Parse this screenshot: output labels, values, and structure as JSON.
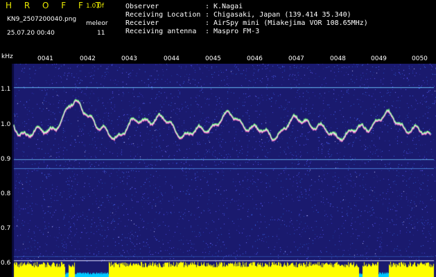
{
  "header": {
    "app_title": "H R O F F T",
    "version": "1.0.0f",
    "file_name": "KN9_2507200040.png",
    "mode_label": "meleor",
    "datetime": "25.07.20 00:40",
    "mode_value": "11",
    "info": [
      {
        "key": "Observer",
        "sep": ":",
        "value": "K.Nagai"
      },
      {
        "key": "Receiving Location",
        "sep": ":",
        "value": "Chigasaki, Japan (139.414 35.340)"
      },
      {
        "key": "Receiver",
        "sep": ":",
        "value": "AirSpy mini (Miakejima VOR 108.65MHz)"
      },
      {
        "key": "Receiving antenna",
        "sep": ":",
        "value": "Maspro FM-3"
      }
    ]
  },
  "axis": {
    "unit": "kHz",
    "time_labels": [
      "0041",
      "0042",
      "0043",
      "0044",
      "0045",
      "0046",
      "0047",
      "0048",
      "0049",
      "0050"
    ],
    "freq_labels": [
      "1.1",
      "1.0",
      "0.9",
      "0.8",
      "0.7",
      "0.6"
    ]
  },
  "colors": {
    "background": "#1a1a6e",
    "title": "#e8e800",
    "trace": "#e8e8ff",
    "bars": "#ffff00",
    "bars_low": "#00c8ff"
  }
}
